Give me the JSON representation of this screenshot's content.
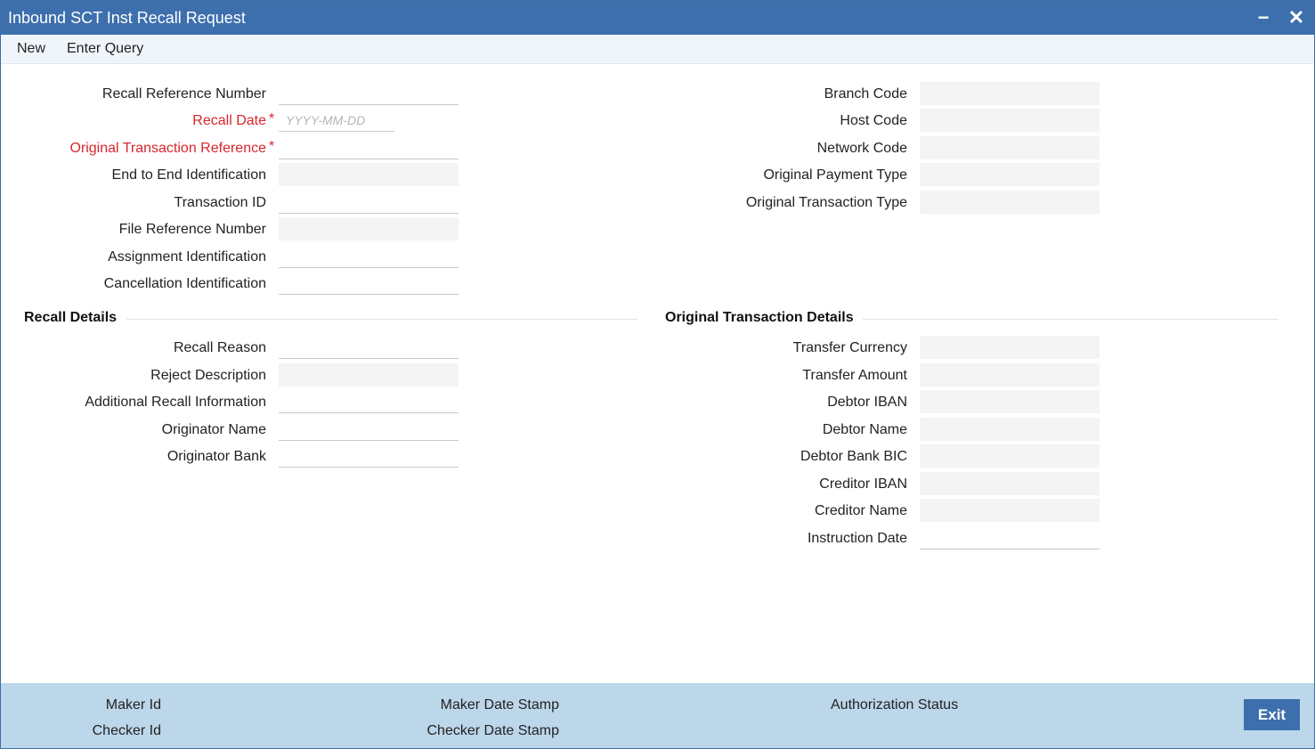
{
  "window": {
    "title": "Inbound SCT Inst Recall Request",
    "minimize": "−",
    "close": "✕"
  },
  "menu": {
    "new": "New",
    "enter_query": "Enter Query"
  },
  "main_left": {
    "recall_reference_number": "Recall Reference Number",
    "recall_date": "Recall Date",
    "recall_date_placeholder": "YYYY-MM-DD",
    "original_transaction_reference": "Original Transaction Reference",
    "end_to_end_identification": "End to End Identification",
    "transaction_id": "Transaction ID",
    "file_reference_number": "File Reference Number",
    "assignment_identification": "Assignment Identification",
    "cancellation_identification": "Cancellation Identification",
    "required_marker": "*"
  },
  "main_right": {
    "branch_code": "Branch Code",
    "host_code": "Host Code",
    "network_code": "Network Code",
    "original_payment_type": "Original Payment Type",
    "original_transaction_type": "Original Transaction Type"
  },
  "recall_details": {
    "heading": "Recall Details",
    "recall_reason": "Recall Reason",
    "reject_description": "Reject Description",
    "additional_recall_information": "Additional Recall Information",
    "originator_name": "Originator Name",
    "originator_bank": "Originator Bank"
  },
  "original_transaction_details": {
    "heading": "Original Transaction Details",
    "transfer_currency": "Transfer Currency",
    "transfer_amount": "Transfer Amount",
    "debtor_iban": "Debtor IBAN",
    "debtor_name": "Debtor Name",
    "debtor_bank_bic": "Debtor Bank BIC",
    "creditor_iban": "Creditor IBAN",
    "creditor_name": "Creditor Name",
    "instruction_date": "Instruction Date"
  },
  "footer": {
    "maker_id": "Maker Id",
    "checker_id": "Checker Id",
    "maker_date_stamp": "Maker Date Stamp",
    "checker_date_stamp": "Checker Date Stamp",
    "authorization_status": "Authorization Status",
    "exit": "Exit"
  }
}
